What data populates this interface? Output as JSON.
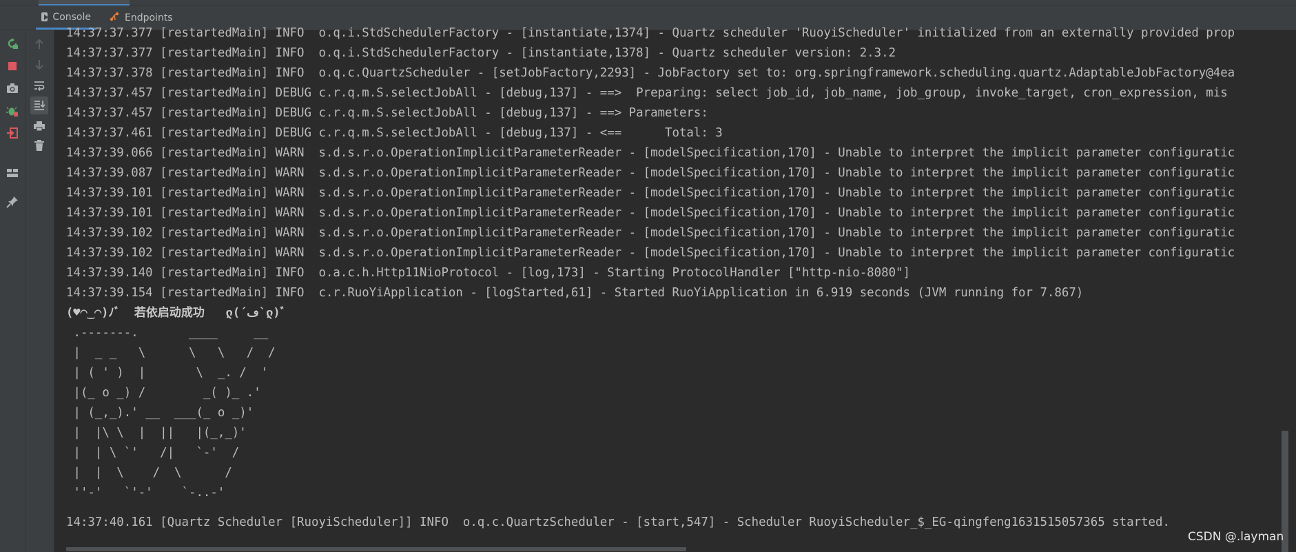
{
  "tabs": [
    {
      "label": "Console",
      "active": true,
      "icon": "console-icon"
    },
    {
      "label": "Endpoints",
      "active": false,
      "icon": "endpoints-icon"
    }
  ],
  "left_toolbar": {
    "icons": [
      "rerun-icon",
      "stop-icon",
      "camera-icon",
      "debug-icon",
      "exit-icon",
      "layout-icon",
      "pin-icon"
    ]
  },
  "console_toolbar": {
    "icons": [
      "up-arrow-icon",
      "down-arrow-icon",
      "soft-wrap-icon",
      "scroll-to-end-icon",
      "print-icon",
      "trash-icon"
    ]
  },
  "console": {
    "lines": [
      "14:37:37.377 [restartedMain] INFO  o.q.i.StdSchedulerFactory - [instantiate,1374] - Quartz scheduler 'RuoyiScheduler' initialized from an externally provided prop",
      "14:37:37.377 [restartedMain] INFO  o.q.i.StdSchedulerFactory - [instantiate,1378] - Quartz scheduler version: 2.3.2",
      "14:37:37.378 [restartedMain] INFO  o.q.c.QuartzScheduler - [setJobFactory,2293] - JobFactory set to: org.springframework.scheduling.quartz.AdaptableJobFactory@4ea",
      "14:37:37.457 [restartedMain] DEBUG c.r.q.m.S.selectJobAll - [debug,137] - ==>  Preparing: select job_id, job_name, job_group, invoke_target, cron_expression, mis",
      "14:37:37.457 [restartedMain] DEBUG c.r.q.m.S.selectJobAll - [debug,137] - ==> Parameters: ",
      "14:37:37.461 [restartedMain] DEBUG c.r.q.m.S.selectJobAll - [debug,137] - <==      Total: 3",
      "14:37:39.066 [restartedMain] WARN  s.d.s.r.o.OperationImplicitParameterReader - [modelSpecification,170] - Unable to interpret the implicit parameter configuratic",
      "14:37:39.087 [restartedMain] WARN  s.d.s.r.o.OperationImplicitParameterReader - [modelSpecification,170] - Unable to interpret the implicit parameter configuratic",
      "14:37:39.101 [restartedMain] WARN  s.d.s.r.o.OperationImplicitParameterReader - [modelSpecification,170] - Unable to interpret the implicit parameter configuratic",
      "14:37:39.101 [restartedMain] WARN  s.d.s.r.o.OperationImplicitParameterReader - [modelSpecification,170] - Unable to interpret the implicit parameter configuratic",
      "14:37:39.102 [restartedMain] WARN  s.d.s.r.o.OperationImplicitParameterReader - [modelSpecification,170] - Unable to interpret the implicit parameter configuratic",
      "14:37:39.102 [restartedMain] WARN  s.d.s.r.o.OperationImplicitParameterReader - [modelSpecification,170] - Unable to interpret the implicit parameter configuratic",
      "14:37:39.140 [restartedMain] INFO  o.a.c.h.Http11NioProtocol - [log,173] - Starting ProtocolHandler [\"http-nio-8080\"]",
      "14:37:39.154 [restartedMain] INFO  c.r.RuoYiApplication - [logStarted,61] - Started RuoYiApplication in 6.919 seconds (JVM running for 7.867)"
    ],
    "banner_line": "(♥◠‿◠)ﾉﾞ  若依启动成功   ლ(´ڡ`ლ)ﾞ",
    "ascii_art": [
      " .-------.       ____     __",
      " |  _ _   \\      \\   \\   /  /",
      " | ( ' )  |       \\  _. /  '",
      " |(_ o _) /        _( )_ .'",
      " | (_,_).' __  ___(_ o _)'",
      " |  |\\ \\  |  ||   |(_,_)'",
      " |  | \\ `'   /|   `-'  /",
      " |  |  \\    /  \\      /",
      " ''-'   `'-'    `-..-'"
    ],
    "final_line": "14:37:40.161 [Quartz Scheduler [RuoyiScheduler]] INFO  o.q.c.QuartzScheduler - [start,547] - Scheduler RuoyiScheduler_$_EG-qingfeng1631515057365 started."
  },
  "watermark": "CSDN @.layman",
  "colors": {
    "console_bg": "#2b2b2b",
    "panel_bg": "#3c3f41",
    "text": "#bbbbbb",
    "accent": "#4a88c7",
    "rerun_green": "#59a869",
    "stop_red": "#db5860"
  }
}
